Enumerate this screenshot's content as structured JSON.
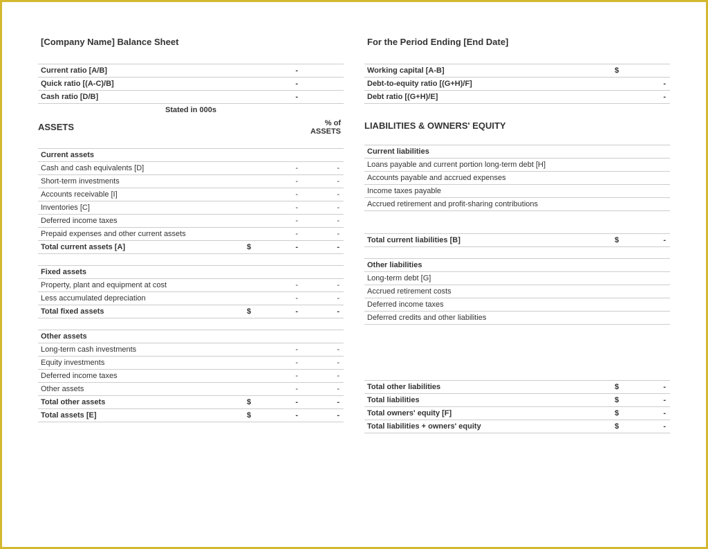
{
  "left": {
    "company_title": "[Company Name] Balance Sheet",
    "ratios": [
      {
        "label": "Current ratio  [A/B]",
        "value": "-"
      },
      {
        "label": "Quick ratio  [(A-C)/B]",
        "value": "-"
      },
      {
        "label": "Cash ratio  [D/B]",
        "value": "-"
      }
    ],
    "stated_in": "Stated in 000s",
    "assets_header": "ASSETS",
    "percent_header": "% of ASSETS",
    "current_assets_header": "Current assets",
    "current_assets": [
      {
        "label": "Cash and cash equivalents  [D]",
        "value": "-",
        "percent": "-"
      },
      {
        "label": "Short-term investments",
        "value": "-",
        "percent": "-"
      },
      {
        "label": "Accounts receivable  [I]",
        "value": "-",
        "percent": "-"
      },
      {
        "label": "Inventories  [C]",
        "value": "-",
        "percent": "-"
      },
      {
        "label": "Deferred income taxes",
        "value": "-",
        "percent": "-"
      },
      {
        "label": "Prepaid expenses and other current assets",
        "value": "-",
        "percent": "-"
      }
    ],
    "total_current_assets": {
      "label": "Total current assets  [A]",
      "currency": "$",
      "value": "-",
      "percent": "-"
    },
    "fixed_assets_header": "Fixed assets",
    "fixed_assets": [
      {
        "label": "Property, plant and equipment at cost",
        "value": "-",
        "percent": "-"
      },
      {
        "label": "Less accumulated depreciation",
        "value": "-",
        "percent": "-"
      }
    ],
    "total_fixed_assets": {
      "label": "Total fixed assets",
      "currency": "$",
      "value": "-",
      "percent": "-"
    },
    "other_assets_header": "Other assets",
    "other_assets": [
      {
        "label": "Long-term cash investments",
        "value": "-",
        "percent": "-"
      },
      {
        "label": "Equity investments",
        "value": "-",
        "percent": "-"
      },
      {
        "label": "Deferred income taxes",
        "value": "-",
        "percent": "-"
      },
      {
        "label": "Other assets",
        "value": "-",
        "percent": "-"
      }
    ],
    "total_other_assets": {
      "label": "Total other assets",
      "currency": "$",
      "value": "-",
      "percent": "-"
    },
    "total_assets": {
      "label": "Total assets  [E]",
      "currency": "$",
      "value": "-",
      "percent": "-"
    }
  },
  "right": {
    "period_title": "For the Period Ending [End Date]",
    "ratios": [
      {
        "label": "Working capital  [A-B]",
        "currency": "$",
        "value": ""
      },
      {
        "label": "Debt-to-equity ratio  [(G+H)/F]",
        "currency": "",
        "value": "-"
      },
      {
        "label": "Debt ratio  [(G+H)/E]",
        "currency": "",
        "value": "-"
      }
    ],
    "liabilities_header": "LIABILITIES & OWNERS' EQUITY",
    "current_liabilities_header": "Current liabilities",
    "current_liabilities": [
      {
        "label": "Loans payable and current portion long-term debt  [H]",
        "value": ""
      },
      {
        "label": "Accounts payable and accrued expenses",
        "value": ""
      },
      {
        "label": "Income taxes payable",
        "value": ""
      },
      {
        "label": "Accrued retirement and profit-sharing contributions",
        "value": ""
      }
    ],
    "total_current_liabilities": {
      "label": "Total current liabilities  [B]",
      "currency": "$",
      "value": "-"
    },
    "other_liabilities_header": "Other liabilities",
    "other_liabilities": [
      {
        "label": "Long-term debt  [G]",
        "value": ""
      },
      {
        "label": "Accrued retirement costs",
        "value": ""
      },
      {
        "label": "Deferred income taxes",
        "value": ""
      },
      {
        "label": "Deferred credits and other liabilities",
        "value": ""
      }
    ],
    "totals": [
      {
        "label": "Total other liabilities",
        "currency": "$",
        "value": "-"
      },
      {
        "label": "Total liabilities",
        "currency": "$",
        "value": "-"
      },
      {
        "label": "Total owners' equity  [F]",
        "currency": "$",
        "value": "-"
      },
      {
        "label": "Total liabilities + owners' equity",
        "currency": "$",
        "value": "-"
      }
    ]
  }
}
